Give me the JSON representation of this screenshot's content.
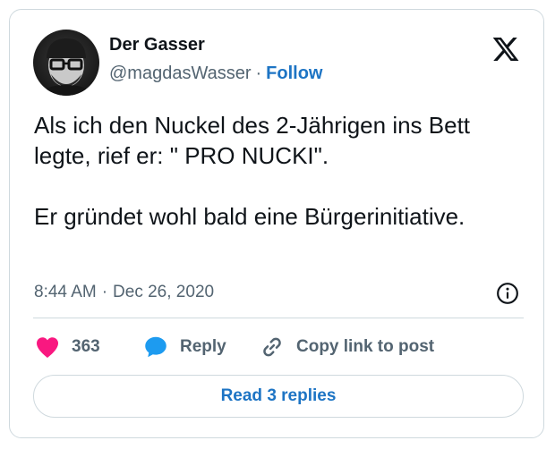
{
  "author": {
    "name": "Der Gasser",
    "handle": "@magdasWasser",
    "separator": "·",
    "follow_label": "Follow"
  },
  "logo_icon": "x-logo-icon",
  "tweet": {
    "paragraphs": [
      "Als ich den Nuckel des 2-Jährigen ins Bett legte, rief er: \" PRO NUCKI\".",
      "Er gründet wohl bald eine Bürgerinitiative."
    ]
  },
  "meta": {
    "time": "8:44 AM",
    "separator": "·",
    "date": "Dec 26, 2020",
    "info_icon": "info-icon"
  },
  "actions": {
    "like_count": "363",
    "like_icon": "heart-icon",
    "like_color": "#f91880",
    "reply_label": "Reply",
    "reply_icon": "speech-bubble-icon",
    "reply_color": "#1d9bf0",
    "copy_label": "Copy link to post",
    "copy_icon": "link-icon"
  },
  "read_replies_label": "Read 3 replies",
  "colors": {
    "link_blue": "#1d74c4",
    "text_primary": "#0f1419",
    "text_secondary": "#536471",
    "border": "#cfd9de"
  }
}
